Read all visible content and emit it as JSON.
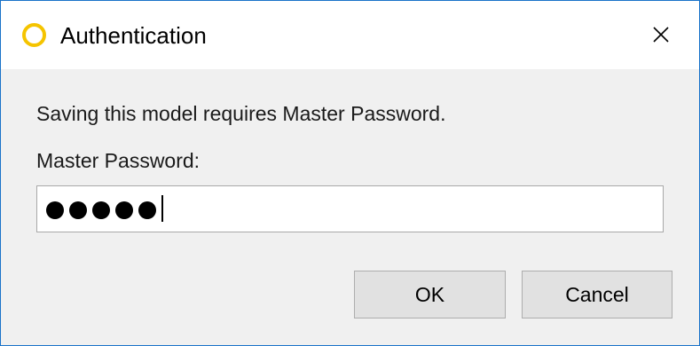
{
  "window": {
    "title": "Authentication",
    "app_icon": "yellow-ring-icon",
    "close_icon": "close-icon"
  },
  "dialog": {
    "message": "Saving this model requires Master Password.",
    "field_label": "Master Password:",
    "password_masked_length": 5,
    "ok_label": "OK",
    "cancel_label": "Cancel"
  },
  "colors": {
    "window_border": "#1a73c9",
    "app_icon_ring": "#f5c400",
    "dialog_background": "#f0f0f0",
    "button_background": "#e1e1e1"
  }
}
